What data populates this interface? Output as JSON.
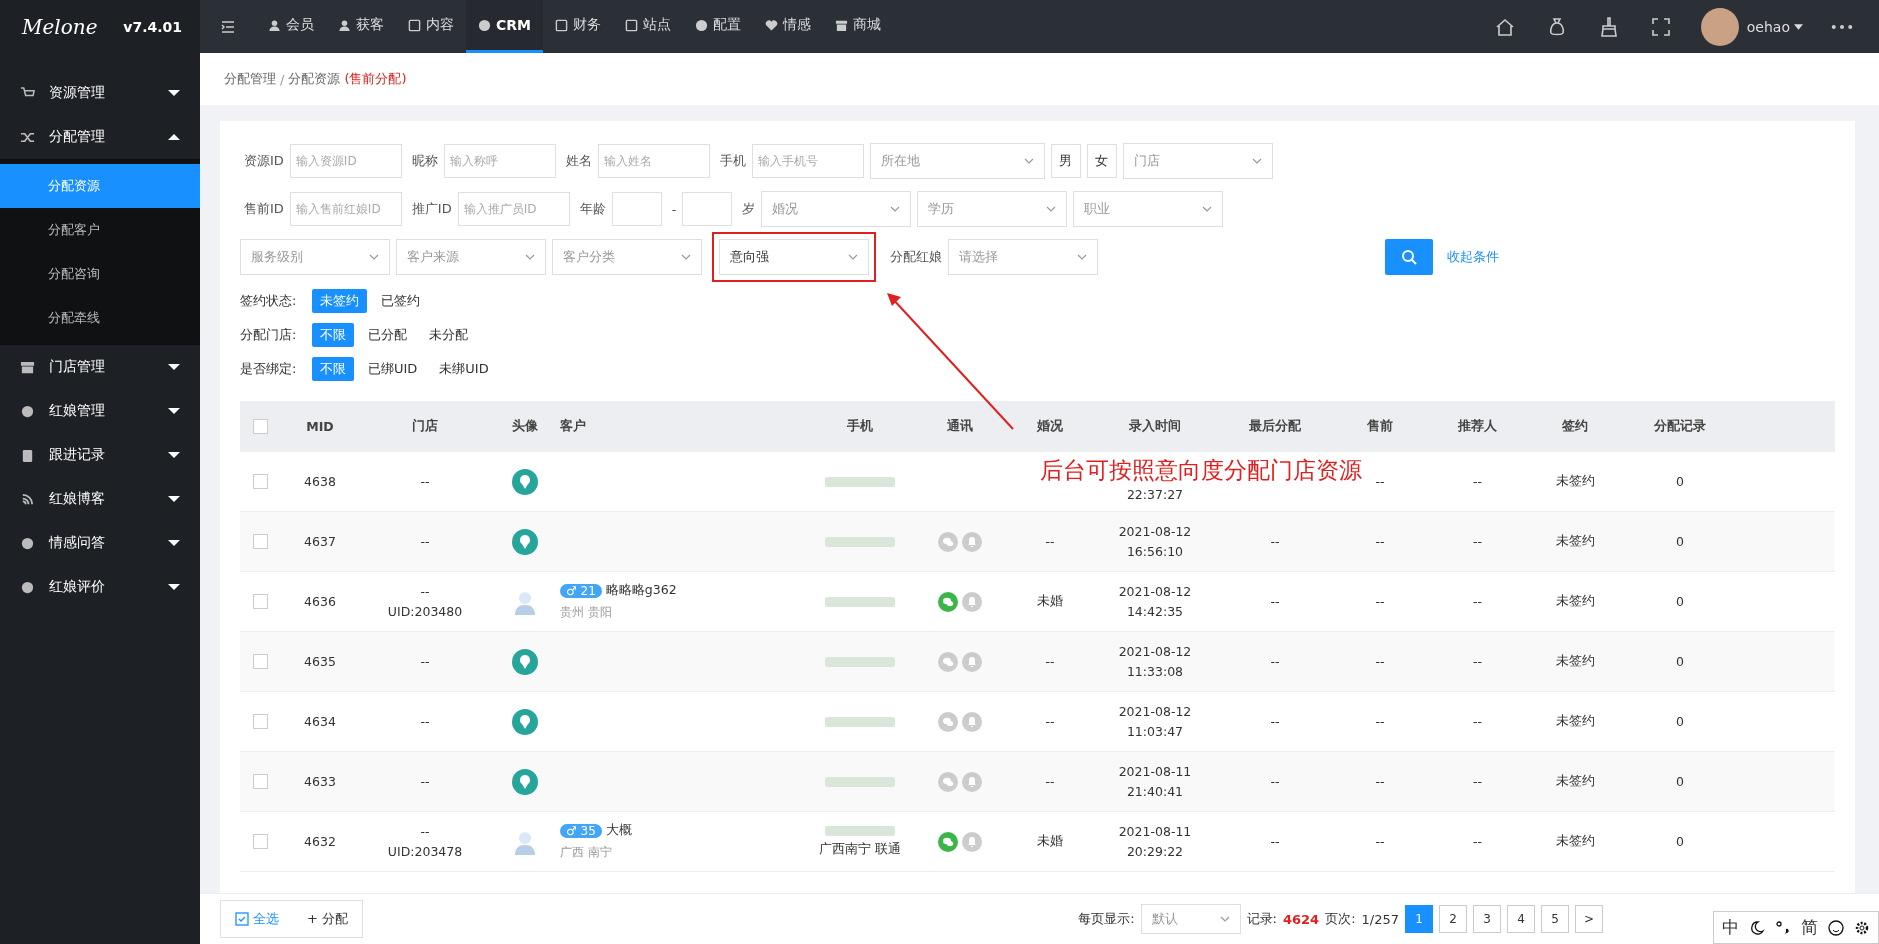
{
  "logo": {
    "text": "Melone",
    "version": "v7.4.01"
  },
  "topnav": [
    {
      "label": "会员",
      "selected": false
    },
    {
      "label": "获客",
      "selected": false
    },
    {
      "label": "内容",
      "selected": false
    },
    {
      "label": "CRM",
      "selected": true
    },
    {
      "label": "财务",
      "selected": false
    },
    {
      "label": "站点",
      "selected": false
    },
    {
      "label": "配置",
      "selected": false
    },
    {
      "label": "情感",
      "selected": false
    },
    {
      "label": "商城",
      "selected": false
    }
  ],
  "user": {
    "name": "oehao"
  },
  "sidebar": {
    "items": [
      {
        "label": "资源管理",
        "expanded": false
      },
      {
        "label": "分配管理",
        "expanded": true,
        "children": [
          {
            "label": "分配资源",
            "selected": true
          },
          {
            "label": "分配客户",
            "selected": false
          },
          {
            "label": "分配咨询",
            "selected": false
          },
          {
            "label": "分配牵线",
            "selected": false
          }
        ]
      },
      {
        "label": "门店管理",
        "expanded": false
      },
      {
        "label": "红娘管理",
        "expanded": false
      },
      {
        "label": "跟进记录",
        "expanded": false
      },
      {
        "label": "红娘博客",
        "expanded": false
      },
      {
        "label": "情感问答",
        "expanded": false
      },
      {
        "label": "红娘评价",
        "expanded": false
      }
    ]
  },
  "breadcrumb": {
    "parent": "分配管理",
    "separator": "/",
    "current": "分配资源",
    "note": "(售前分配)"
  },
  "filters": [
    [
      {
        "kind": "input",
        "label": "资源ID",
        "placeholder": "输入资源ID"
      },
      {
        "kind": "input",
        "label": "昵称",
        "placeholder": "输入称呼"
      },
      {
        "kind": "input",
        "label": "姓名",
        "placeholder": "输入姓名"
      },
      {
        "kind": "input",
        "label": "手机",
        "placeholder": "输入手机号"
      },
      {
        "kind": "select",
        "placeholder": "所在地"
      },
      {
        "kind": "toggle",
        "text": "男"
      },
      {
        "kind": "toggle",
        "text": "女"
      },
      {
        "kind": "select",
        "placeholder": "门店"
      }
    ],
    [
      {
        "kind": "input",
        "label": "售前ID",
        "placeholder": "输入售前红娘ID"
      },
      {
        "kind": "input",
        "label": "推广ID",
        "placeholder": "输入推广员ID"
      },
      {
        "kind": "age",
        "label": "年龄",
        "sep": "-",
        "unit": "岁"
      },
      {
        "kind": "select",
        "placeholder": "婚况"
      },
      {
        "kind": "select",
        "placeholder": "学历"
      },
      {
        "kind": "select",
        "placeholder": "职业"
      }
    ],
    [
      {
        "kind": "select",
        "placeholder": "服务级别"
      },
      {
        "kind": "select",
        "placeholder": "客户来源"
      },
      {
        "kind": "select",
        "placeholder": "客户分类"
      },
      {
        "kind": "select",
        "value": "意向强",
        "highlighted": true
      },
      {
        "kind": "select",
        "label": "分配红娘",
        "placeholder": "请选择"
      }
    ]
  ],
  "collapse_link": "收起条件",
  "chip_groups": [
    {
      "label": "签约状态:",
      "options": [
        {
          "text": "未签约",
          "selected": true
        },
        {
          "text": "已签约",
          "selected": false
        }
      ]
    },
    {
      "label": "分配门店:",
      "options": [
        {
          "text": "不限",
          "selected": true
        },
        {
          "text": "已分配",
          "selected": false
        },
        {
          "text": "未分配",
          "selected": false
        }
      ]
    },
    {
      "label": "是否绑定:",
      "options": [
        {
          "text": "不限",
          "selected": true
        },
        {
          "text": "已绑UID",
          "selected": false
        },
        {
          "text": "未绑UID",
          "selected": false
        }
      ]
    }
  ],
  "annotation": "后台可按照意向度分配门店资源",
  "table": {
    "all_checked": false,
    "columns": [
      "MID",
      "门店",
      "头像",
      "客户",
      "手机",
      "通讯",
      "婚况",
      "录入时间",
      "最后分配",
      "售前",
      "推荐人",
      "签约",
      "分配记录"
    ],
    "rows": [
      {
        "kind": "guest",
        "checked": false,
        "mid": "4638",
        "store": "--",
        "time": "22:37:27",
        "presale": "--",
        "referrer": "--",
        "sign": "未签约",
        "records": "0"
      },
      {
        "kind": "guest",
        "checked": false,
        "mid": "4637",
        "store": "--",
        "wechat": false,
        "marriage": "--",
        "date": "2021-08-12",
        "time": "16:56:10",
        "last": "--",
        "presale": "--",
        "referrer": "--",
        "sign": "未签约",
        "records": "0"
      },
      {
        "kind": "member",
        "checked": false,
        "mid": "4636",
        "store": "--",
        "uid": "UID:203480",
        "customer": {
          "gender": "♂",
          "age": "21",
          "name": "略略略g362",
          "location": "贵州 贵阳"
        },
        "wechat": true,
        "marriage": "未婚",
        "date": "2021-08-12",
        "time": "14:42:35",
        "last": "--",
        "presale": "--",
        "referrer": "--",
        "sign": "未签约",
        "records": "0"
      },
      {
        "kind": "guest",
        "checked": false,
        "mid": "4635",
        "store": "--",
        "wechat": false,
        "marriage": "--",
        "date": "2021-08-12",
        "time": "11:33:08",
        "last": "--",
        "presale": "--",
        "referrer": "--",
        "sign": "未签约",
        "records": "0"
      },
      {
        "kind": "guest",
        "checked": false,
        "mid": "4634",
        "store": "--",
        "wechat": false,
        "marriage": "--",
        "date": "2021-08-12",
        "time": "11:03:47",
        "last": "--",
        "presale": "--",
        "referrer": "--",
        "sign": "未签约",
        "records": "0"
      },
      {
        "kind": "guest",
        "checked": false,
        "mid": "4633",
        "store": "--",
        "wechat": false,
        "marriage": "--",
        "date": "2021-08-11",
        "time": "21:40:41",
        "last": "--",
        "presale": "--",
        "referrer": "--",
        "sign": "未签约",
        "records": "0"
      },
      {
        "kind": "member",
        "checked": false,
        "mid": "4632",
        "store": "--",
        "uid": "UID:203478",
        "customer": {
          "gender": "♂",
          "age": "35",
          "name": "大概",
          "location": "广西 南宁"
        },
        "region": "广西南宁 联通",
        "wechat": true,
        "marriage": "未婚",
        "date": "2021-08-11",
        "time": "20:29:22",
        "last": "--",
        "presale": "--",
        "referrer": "--",
        "sign": "未签约",
        "records": "0"
      }
    ]
  },
  "footer": {
    "select_all": "全选",
    "assign": "+ 分配",
    "per_page_label": "每页显示:",
    "per_page": "默认",
    "records_label": "记录:",
    "records": "4624",
    "pages_label": "页次:",
    "pages": "1/257",
    "page_buttons": [
      {
        "text": "1",
        "selected": true
      },
      {
        "text": "2",
        "selected": false
      },
      {
        "text": "3",
        "selected": false
      },
      {
        "text": "4",
        "selected": false
      },
      {
        "text": "5",
        "selected": false
      },
      {
        "text": ">",
        "selected": false
      }
    ]
  },
  "ime_bar": {
    "mode": "中",
    "script": "简"
  }
}
